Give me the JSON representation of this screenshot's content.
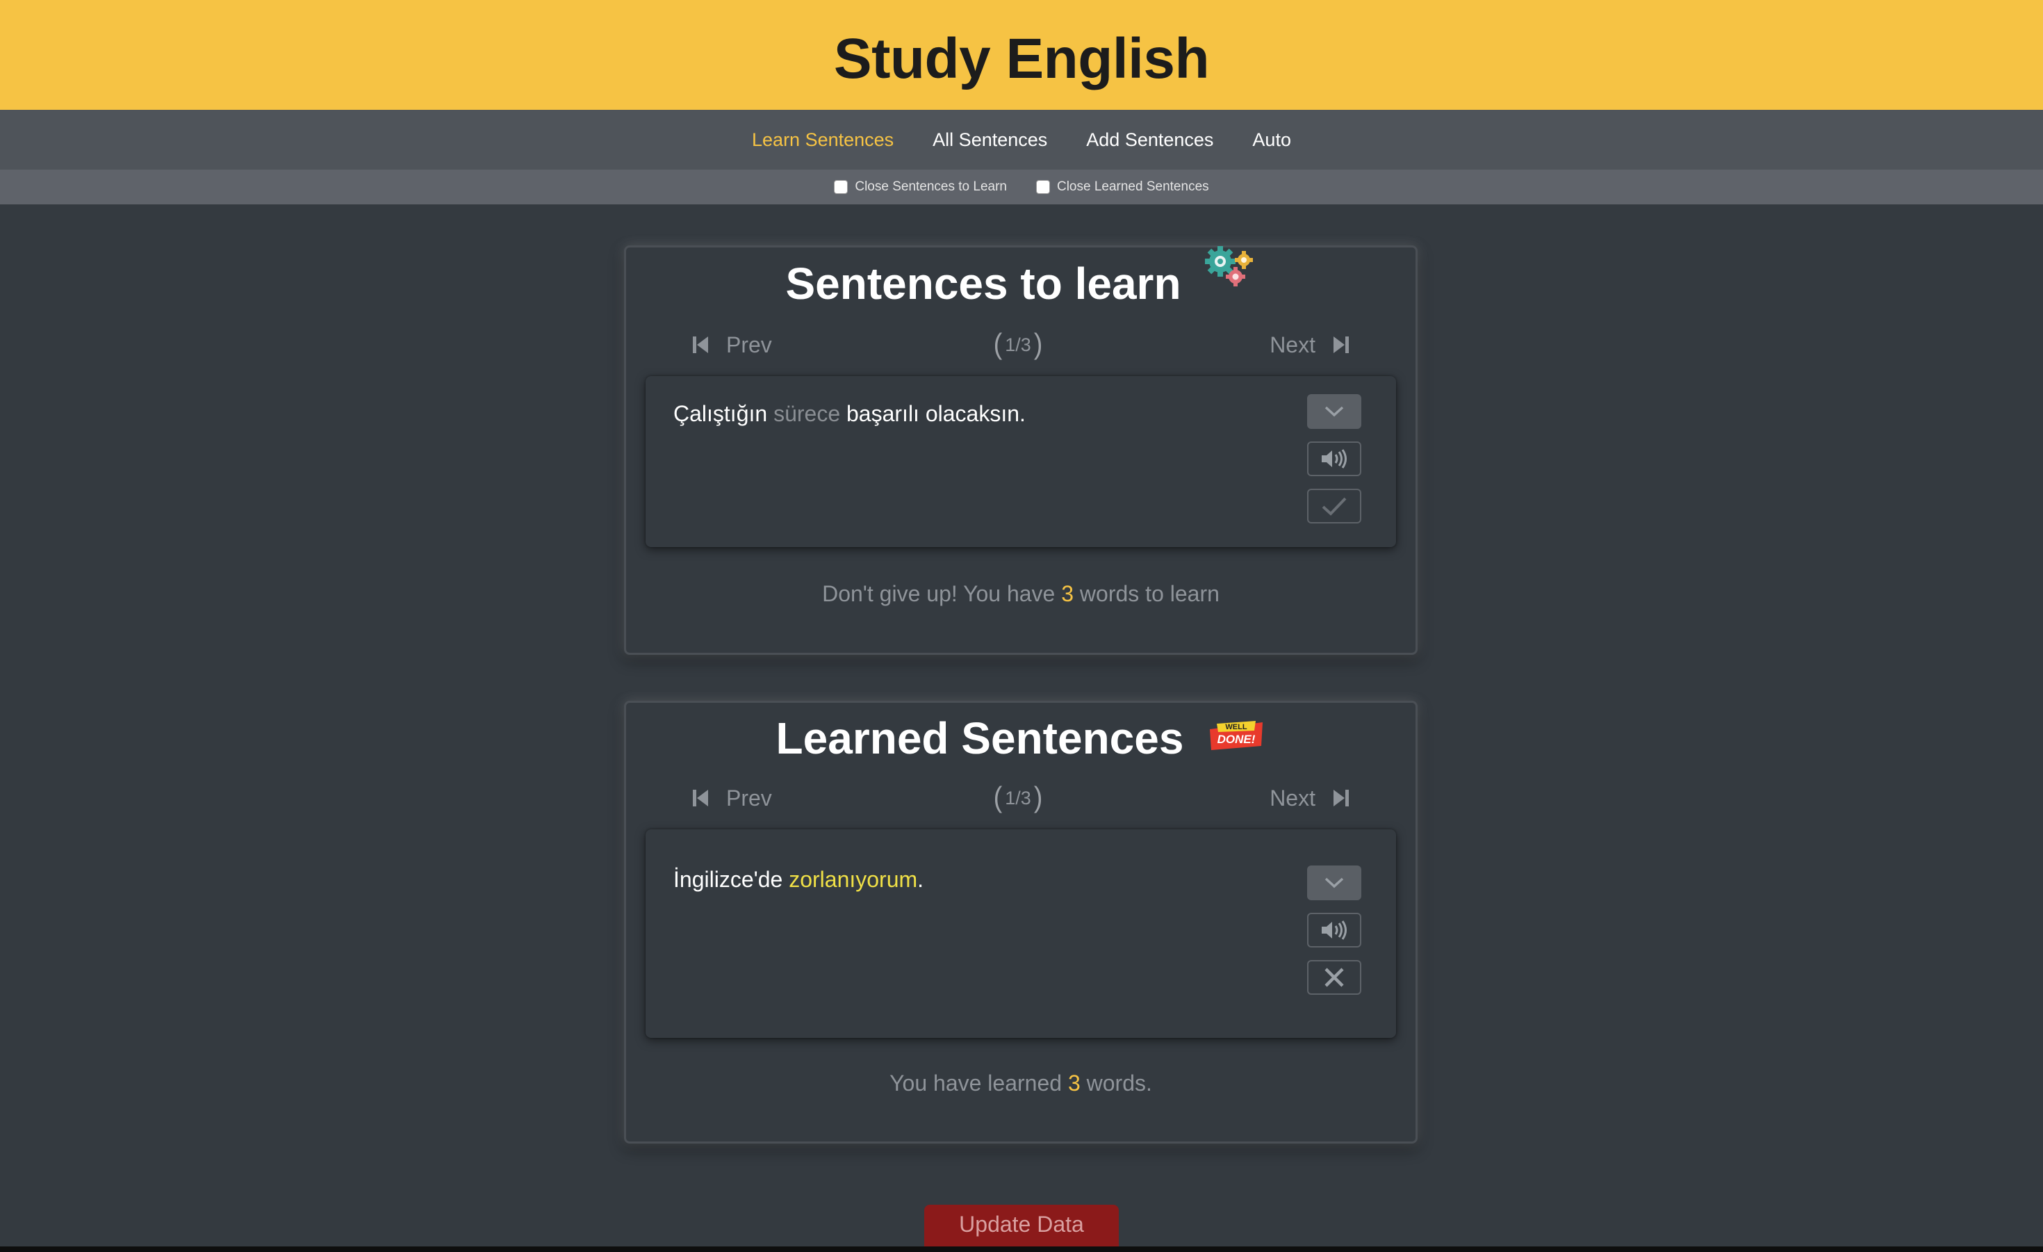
{
  "header": {
    "title": "Study English"
  },
  "nav": {
    "items": [
      {
        "label": "Learn Sentences",
        "active": true
      },
      {
        "label": "All Sentences",
        "active": false
      },
      {
        "label": "Add Sentences",
        "active": false
      },
      {
        "label": "Auto",
        "active": false
      }
    ]
  },
  "options": {
    "close_to_learn": {
      "label": "Close Sentences to Learn",
      "checked": false
    },
    "close_learned": {
      "label": "Close Learned Sentences",
      "checked": false
    }
  },
  "learn_panel": {
    "title": "Sentences to learn",
    "title_icon": "gears-icon",
    "pager": {
      "prev": "Prev",
      "next": "Next",
      "count": "1/3"
    },
    "sentence": {
      "before": "Çalıştığın ",
      "highlight": "sürece",
      "after": " başarılı olacaksın."
    },
    "footer": {
      "before": "Don't give up! You have ",
      "count": "3",
      "after": " words to learn"
    }
  },
  "learned_panel": {
    "title": "Learned Sentences",
    "badge": {
      "line1": "WELL",
      "line2": "DONE!"
    },
    "pager": {
      "prev": "Prev",
      "next": "Next",
      "count": "1/3"
    },
    "sentence": {
      "before": "İngilizce'de ",
      "highlight": "zorlanıyorum",
      "after": "."
    },
    "footer": {
      "before": "You have learned ",
      "count": "3",
      "after": " words."
    }
  },
  "update_button": {
    "label": "Update Data"
  },
  "colors": {
    "accent": "#f6c344",
    "background": "#343a40",
    "nav": "#4f545a",
    "highlight_learned": "#f0e046",
    "danger": "#8b1a1a"
  }
}
